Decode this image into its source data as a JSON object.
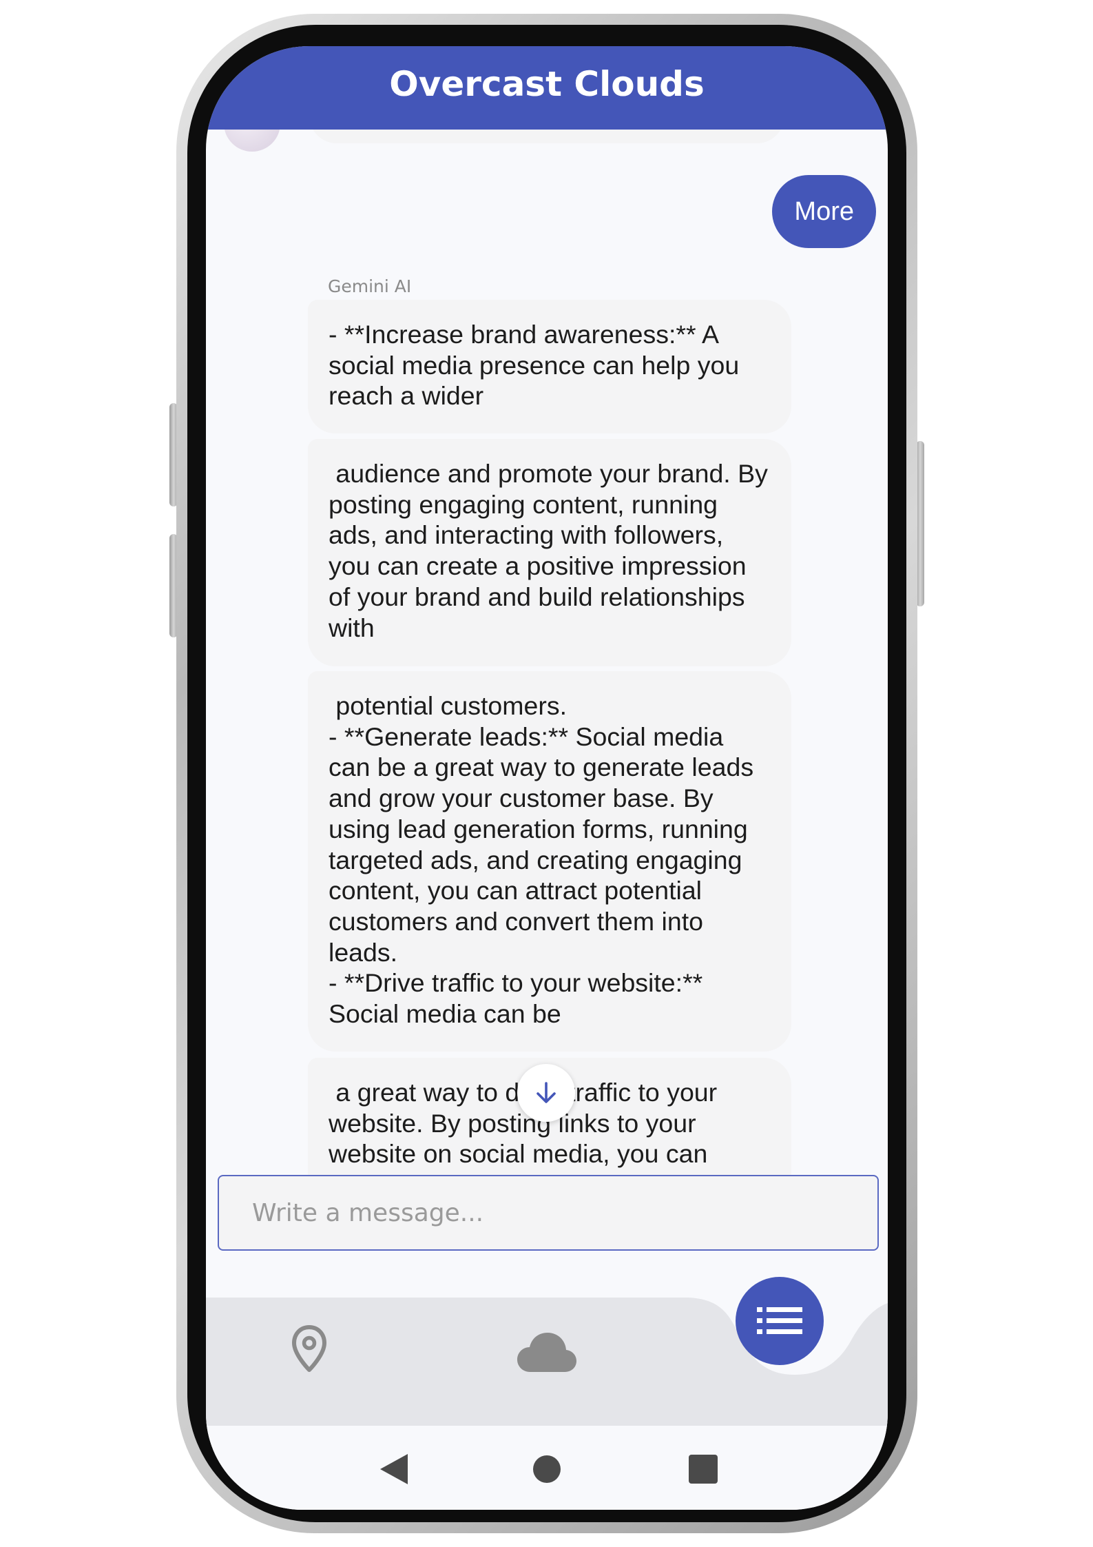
{
  "app": {
    "title": "Overcast Clouds"
  },
  "chat": {
    "user_message": "More",
    "sender_label": "Gemini AI",
    "messages": [
      "- **Increase brand awareness:** A social media presence can help you reach a wider",
      " audience and promote your brand. By posting engaging content, running ads, and interacting with followers, you can create a positive impression of your brand and build relationships with",
      " potential customers.\n- **Generate leads:** Social media can be a great way to generate leads and grow your customer base. By using lead generation forms, running targeted ads, and creating engaging content, you can attract potential customers and convert them into leads.\n- **Drive traffic to your website:** Social media can be",
      " a great way to drive traffic to your website. By posting links to your website on social media, you can"
    ]
  },
  "composer": {
    "placeholder": "Write a message..."
  },
  "icons": {
    "scroll_down": "arrow-down-icon",
    "nav_location": "location-pin-icon",
    "nav_weather": "cloud-icon",
    "fab": "list-icon",
    "sys_back": "back-triangle-icon",
    "sys_home": "home-circle-icon",
    "sys_recents": "recents-square-icon"
  },
  "colors": {
    "primary": "#4456b8",
    "bubble": "#f4f4f5",
    "nav_background": "#e4e5e9",
    "nav_icon": "#8a8a8a"
  }
}
